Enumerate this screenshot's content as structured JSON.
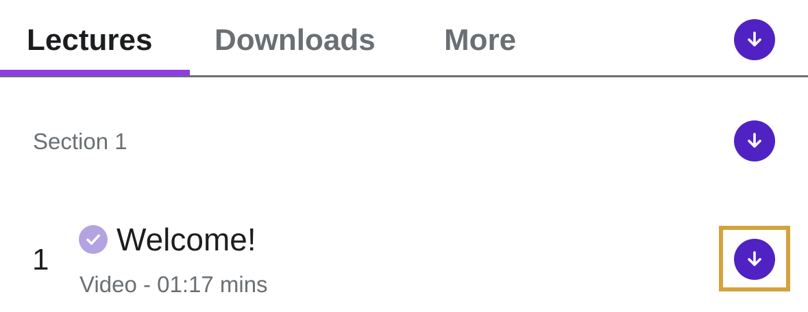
{
  "tabs": [
    {
      "label": "Lectures",
      "active": true
    },
    {
      "label": "Downloads",
      "active": false
    },
    {
      "label": "More",
      "active": false
    }
  ],
  "header": {
    "download_all_icon": "download-arrow-circle-icon"
  },
  "section": {
    "title": "Section 1",
    "download_icon": "download-arrow-circle-icon"
  },
  "lecture": {
    "number": "1",
    "title": "Welcome!",
    "meta": "Video - 01:17 mins",
    "completed_icon": "check-circle-icon",
    "download_icon": "download-arrow-circle-icon"
  },
  "colors": {
    "accent": "#5022c3",
    "tab_indicator": "#8f3ce0",
    "completed_check": "#b3a3e0",
    "highlight": "#d4a33d",
    "text_primary": "#1c1d1f",
    "text_secondary": "#6a6f73"
  }
}
